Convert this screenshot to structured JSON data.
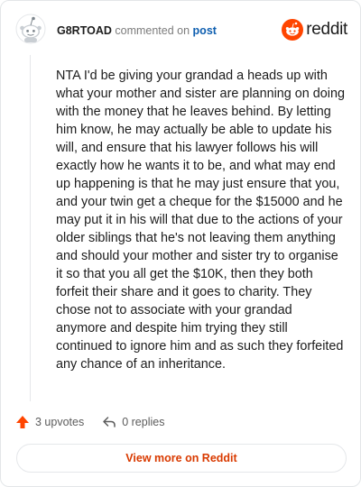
{
  "header": {
    "username": "G8RTOAD",
    "action_text": "commented on",
    "post_link": "post"
  },
  "brand": {
    "name": "reddit",
    "color": "#ff4500",
    "icon": "reddit-logo-icon"
  },
  "comment": {
    "body": "NTA I'd be giving your grandad a heads up with what your mother and sister are planning on doing with the money that he leaves behind. By letting him know, he may actually be able to update his will, and ensure that his lawyer follows his will exactly how he wants it to be, and what may end up happening is that he may just ensure that you, and your twin get a cheque for the $15000 and he may put it in his will that due to the actions of your older siblings that he's not leaving them anything and should your mother and sister try to organise it so that you all get the $10K, then they both forfeit their share and it goes to charity. They chose not to associate with your grandad anymore and despite him trying they still continued to ignore him and as such they forfeited any chance of an inheritance."
  },
  "footer": {
    "upvotes": "3 upvotes",
    "replies": "0 replies",
    "upvote_icon": "upvote-arrow-icon",
    "reply_icon": "reply-arrow-icon",
    "upvote_color": "#ff4500"
  },
  "view_more": {
    "label": "View more on Reddit",
    "color": "#d93a00"
  }
}
